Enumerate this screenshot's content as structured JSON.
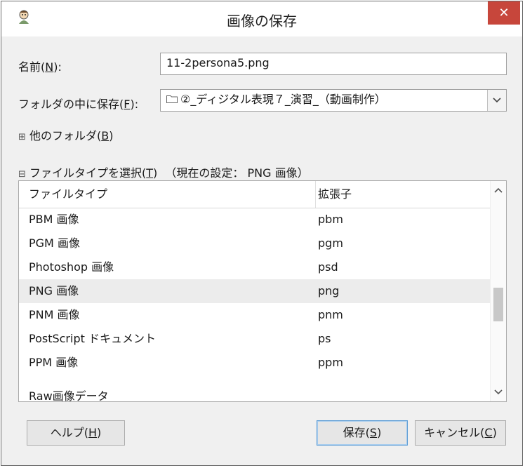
{
  "window": {
    "title": "画像の保存",
    "close_glyph": "✕",
    "app_icon": "gimp-icon"
  },
  "name_row": {
    "label_prefix": "名前(",
    "label_key": "N",
    "label_suffix": "):",
    "value": "11-2persona5.png"
  },
  "folder_row": {
    "label_prefix": "フォルダの中に保存(",
    "label_key": "F",
    "label_suffix": "):",
    "value": "②_ディジタル表現７_演習_（動画制作）"
  },
  "other_folders": {
    "expander": "⊞",
    "label_prefix": "他のフォルダ(",
    "label_key": "B",
    "label_suffix": ")"
  },
  "file_type_section": {
    "expander": "⊟",
    "label_prefix": "ファイルタイプを選択(",
    "label_key": "T",
    "label_suffix": ")",
    "current_setting": "（現在の設定： PNG 画像）"
  },
  "file_types": {
    "columns": [
      "ファイルタイプ",
      "拡張子"
    ],
    "rows": [
      {
        "type": "PBM 画像",
        "ext": "pbm"
      },
      {
        "type": "PGM 画像",
        "ext": "pgm"
      },
      {
        "type": "Photoshop 画像",
        "ext": "psd"
      },
      {
        "type": "PNG 画像",
        "ext": "png",
        "selected": true
      },
      {
        "type": "PNM 画像",
        "ext": "pnm"
      },
      {
        "type": "PostScript ドキュメント",
        "ext": "ps"
      },
      {
        "type": "PPM 画像",
        "ext": "ppm"
      },
      {
        "type": "Raw画像データ",
        "ext": ""
      }
    ]
  },
  "buttons": {
    "help": {
      "prefix": "ヘルプ(",
      "key": "H",
      "suffix": ")"
    },
    "save": {
      "prefix": "保存(",
      "key": "S",
      "suffix": ")"
    },
    "cancel": {
      "prefix": "キャンセル(",
      "key": "C",
      "suffix": ")"
    }
  },
  "colors": {
    "close_button": "#c7463b",
    "selection": "#ececec",
    "default_button_border": "#5b9bd5"
  }
}
